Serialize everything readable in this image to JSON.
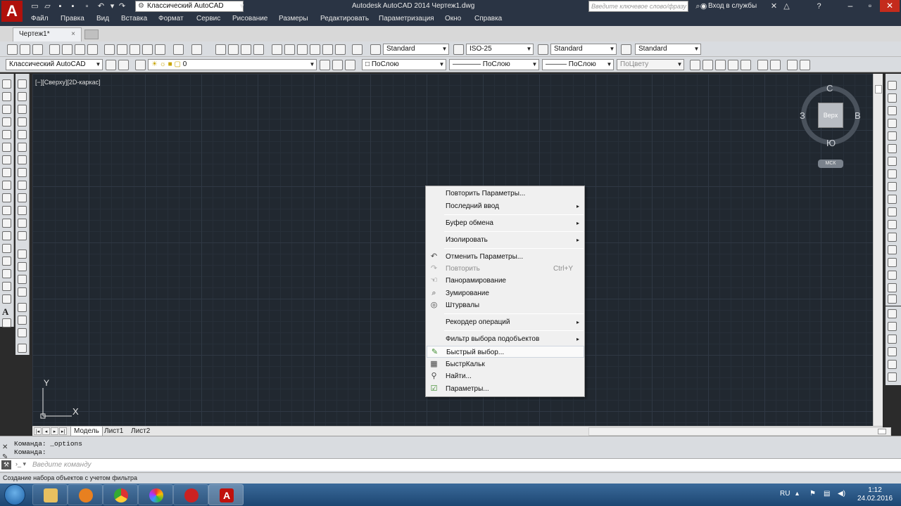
{
  "titlebar": {
    "workspace": "Классический AutoCAD",
    "title": "Autodesk AutoCAD 2014   Чертеж1.dwg",
    "search_placeholder": "Введите ключевое слово/фразу",
    "signin": "Вход в службы",
    "help": "?"
  },
  "menubar": [
    "Файл",
    "Правка",
    "Вид",
    "Вставка",
    "Формат",
    "Сервис",
    "Рисование",
    "Размеры",
    "Редактировать",
    "Параметризация",
    "Окно",
    "Справка"
  ],
  "doc_tab": {
    "label": "Чертеж1*",
    "close": "×"
  },
  "styles_toolbar": {
    "text_style": "Standard",
    "dim_style": "ISO-25",
    "table_style": "Standard",
    "mleader_style": "Standard"
  },
  "layers_toolbar": {
    "workspace": "Классический AutoCAD",
    "layer": "0",
    "color": "ПоСлою",
    "linetype": "ПоСлою",
    "lineweight": "ПоСлою",
    "plotstyle": "ПоЦвету"
  },
  "viewport": {
    "label": "[−][Сверху][2D-каркас]"
  },
  "viewcube": {
    "top_face": "Верх",
    "north": "С",
    "south": "Ю",
    "east": "В",
    "west": "З",
    "ucs": "МСК"
  },
  "ucs_icon": {
    "x": "X",
    "y": "Y"
  },
  "layout_tabs": [
    "Модель",
    "Лист1",
    "Лист2"
  ],
  "context_menu": {
    "items": [
      {
        "label": "Повторить Параметры...",
        "icon": ""
      },
      {
        "label": "Последний ввод",
        "submenu": "▸"
      },
      {
        "label": "Буфер обмена",
        "submenu": "▸"
      },
      {
        "label": "Изолировать",
        "submenu": "▸"
      },
      {
        "label": "Отменить Параметры...",
        "icon": "undo-icon"
      },
      {
        "label": "Повторить",
        "shortcut": "Ctrl+Y",
        "disabled": true,
        "icon": "redo-icon"
      },
      {
        "label": "Панорамирование",
        "icon": "pan-icon"
      },
      {
        "label": "Зумирование",
        "icon": "zoom-icon"
      },
      {
        "label": "Штурвалы",
        "icon": "steeringwheel-icon"
      },
      {
        "label": "Рекордер операций",
        "submenu": "▸"
      },
      {
        "label": "Фильтр выбора подобъектов",
        "submenu": "▸"
      },
      {
        "label": "Быстрый выбор...",
        "icon": "quickselect-icon"
      },
      {
        "label": "БыстрКальк",
        "icon": "calculator-icon"
      },
      {
        "label": "Найти...",
        "icon": "find-icon"
      },
      {
        "label": "Параметры...",
        "icon": "options-icon"
      }
    ]
  },
  "command_line": {
    "history": [
      "Команда:  _options",
      "Команда:"
    ],
    "input_placeholder": "Введите команду"
  },
  "status_text": "Создание набора объектов с учетом фильтра",
  "taskbar": {
    "lang": "RU",
    "time": "1:12",
    "date": "24.02.2016"
  }
}
